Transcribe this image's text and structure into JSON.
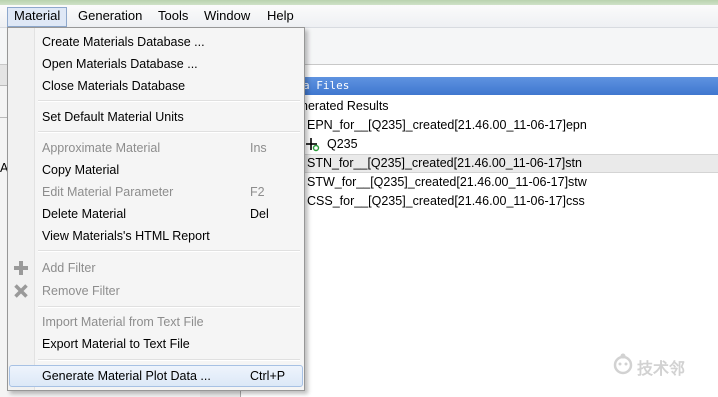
{
  "menubar": {
    "items": [
      {
        "label": "Material"
      },
      {
        "label": "Generation"
      },
      {
        "label": "Tools"
      },
      {
        "label": "Window"
      },
      {
        "label": "Help"
      }
    ]
  },
  "panel": {
    "header": "a Files"
  },
  "tree": {
    "rows": [
      {
        "label": "nerated Results"
      },
      {
        "label": "EPN_for__[Q235]_created[21.46.00_11-06-17]epn"
      },
      {
        "label": "Q235"
      },
      {
        "label": "STN_for__[Q235]_created[21.46.00_11-06-17]stn"
      },
      {
        "label": "STW_for__[Q235]_created[21.46.00_11-06-17]stw"
      },
      {
        "label": "CSS_for__[Q235]_created[21.46.00_11-06-17]css"
      }
    ]
  },
  "left_panel": {
    "cut_text": "A"
  },
  "dropdown": {
    "items": [
      {
        "label": "Create Materials Database ...",
        "shortcut": "",
        "disabled": false
      },
      {
        "label": "Open Materials Database ...",
        "shortcut": "",
        "disabled": false
      },
      {
        "label": "Close Materials Database",
        "shortcut": "",
        "disabled": false
      },
      {
        "label": "Set Default Material Units",
        "shortcut": "",
        "disabled": false
      },
      {
        "label": "Approximate Material",
        "shortcut": "Ins",
        "disabled": true
      },
      {
        "label": "Copy Material",
        "shortcut": "",
        "disabled": false
      },
      {
        "label": "Edit Material Parameter",
        "shortcut": "F2",
        "disabled": true
      },
      {
        "label": "Delete Material",
        "shortcut": "Del",
        "disabled": false
      },
      {
        "label": "View Materials's HTML Report",
        "shortcut": "",
        "disabled": false
      },
      {
        "label": "Add Filter",
        "shortcut": "",
        "disabled": true,
        "icon": "plus-icon"
      },
      {
        "label": "Remove Filter",
        "shortcut": "",
        "disabled": true,
        "icon": "x-icon"
      },
      {
        "label": "Import Material from Text File",
        "shortcut": "",
        "disabled": true
      },
      {
        "label": "Export Material to Text File",
        "shortcut": "",
        "disabled": false
      },
      {
        "label": "Generate Material Plot Data ...",
        "shortcut": "Ctrl+P",
        "disabled": false
      }
    ]
  },
  "watermark": {
    "text": "技术邻"
  },
  "colors": {
    "panel_header": "#4a82d6",
    "menu_hover_border": "#a7c1e4",
    "disabled_text": "#8d8d8d"
  }
}
